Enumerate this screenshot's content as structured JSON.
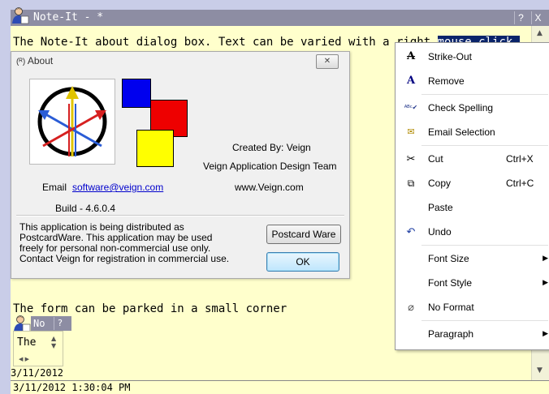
{
  "window": {
    "title": "Note-It - *",
    "help_button": "?",
    "close_button": "X"
  },
  "note": {
    "line1_text": "The Note-It about dialog box.  Text can be varied with a right ",
    "line1_selected": "mouse click.",
    "line2": "The form can be parked in a small corner"
  },
  "about": {
    "title": "About",
    "close_label": "✕",
    "created_by": "Created By: Veign",
    "team": "Veign Application Design Team",
    "email_label": "Email",
    "email": "software@veign.com",
    "website": "www.Veign.com",
    "build": "Build - 4.6.0.4",
    "info": "This application is being distributed as\nPostcardWare.  This application may be used\nfreely for personal non-commercial use only.\nContact Veign for registration in commercial use.",
    "postcard_button": "Postcard Ware",
    "ok_button": "OK"
  },
  "menu": {
    "items": [
      {
        "label": "Strike-Out",
        "icon": "strikeout-icon",
        "shortcut": ""
      },
      {
        "label": "Remove",
        "icon": "font-a-icon",
        "shortcut": ""
      },
      {
        "label": "Check Spelling",
        "icon": "spellcheck-icon",
        "shortcut": ""
      },
      {
        "label": "Email Selection",
        "icon": "email-icon",
        "shortcut": ""
      },
      {
        "label": "Cut",
        "icon": "scissors-icon",
        "shortcut": "Ctrl+X"
      },
      {
        "label": "Copy",
        "icon": "copy-icon",
        "shortcut": "Ctrl+C"
      },
      {
        "label": "Paste",
        "icon": "",
        "shortcut": ""
      },
      {
        "label": "Undo",
        "icon": "undo-icon",
        "shortcut": ""
      },
      {
        "label": "Font Size",
        "icon": "",
        "shortcut": "",
        "submenu": true
      },
      {
        "label": "Font Style",
        "icon": "",
        "shortcut": "",
        "submenu": true
      },
      {
        "label": "No Format",
        "icon": "eraser-icon",
        "shortcut": ""
      },
      {
        "label": "Paragraph",
        "icon": "",
        "shortcut": "",
        "submenu": true
      }
    ]
  },
  "mini_note": {
    "title": "No",
    "help_button": "?",
    "text": "The",
    "stamp": "3/11/2012"
  },
  "status": {
    "timestamp": "3/11/2012 1:30:04 PM"
  },
  "colors": {
    "titlebar": "#8d8da3",
    "note_bg": "#ffffcc",
    "selection": "#0a246a"
  }
}
